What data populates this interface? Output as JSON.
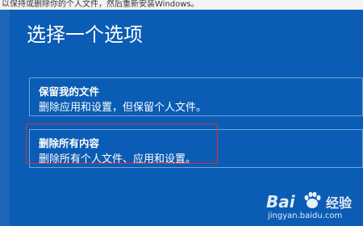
{
  "top_strip_text": "以保持或删除你的个人文件，然后重新安装Windows。",
  "dialog": {
    "title": "选择一个选项",
    "options": [
      {
        "label": "保留我的文件",
        "description": "删除应用和设置，但保留个人文件。"
      },
      {
        "label": "删除所有内容",
        "description": "删除所有个人文件、应用和设置。"
      }
    ]
  },
  "annotation": {
    "highlight_color": "#d9303a",
    "target": "删除所有内容"
  },
  "watermark": {
    "logo_text": "Bai",
    "logo_suffix": "经验",
    "url": "jingyan.baidu.com"
  },
  "colors": {
    "background": "#0b5cb4",
    "text": "#ffffff",
    "border": "#6da7e0"
  }
}
